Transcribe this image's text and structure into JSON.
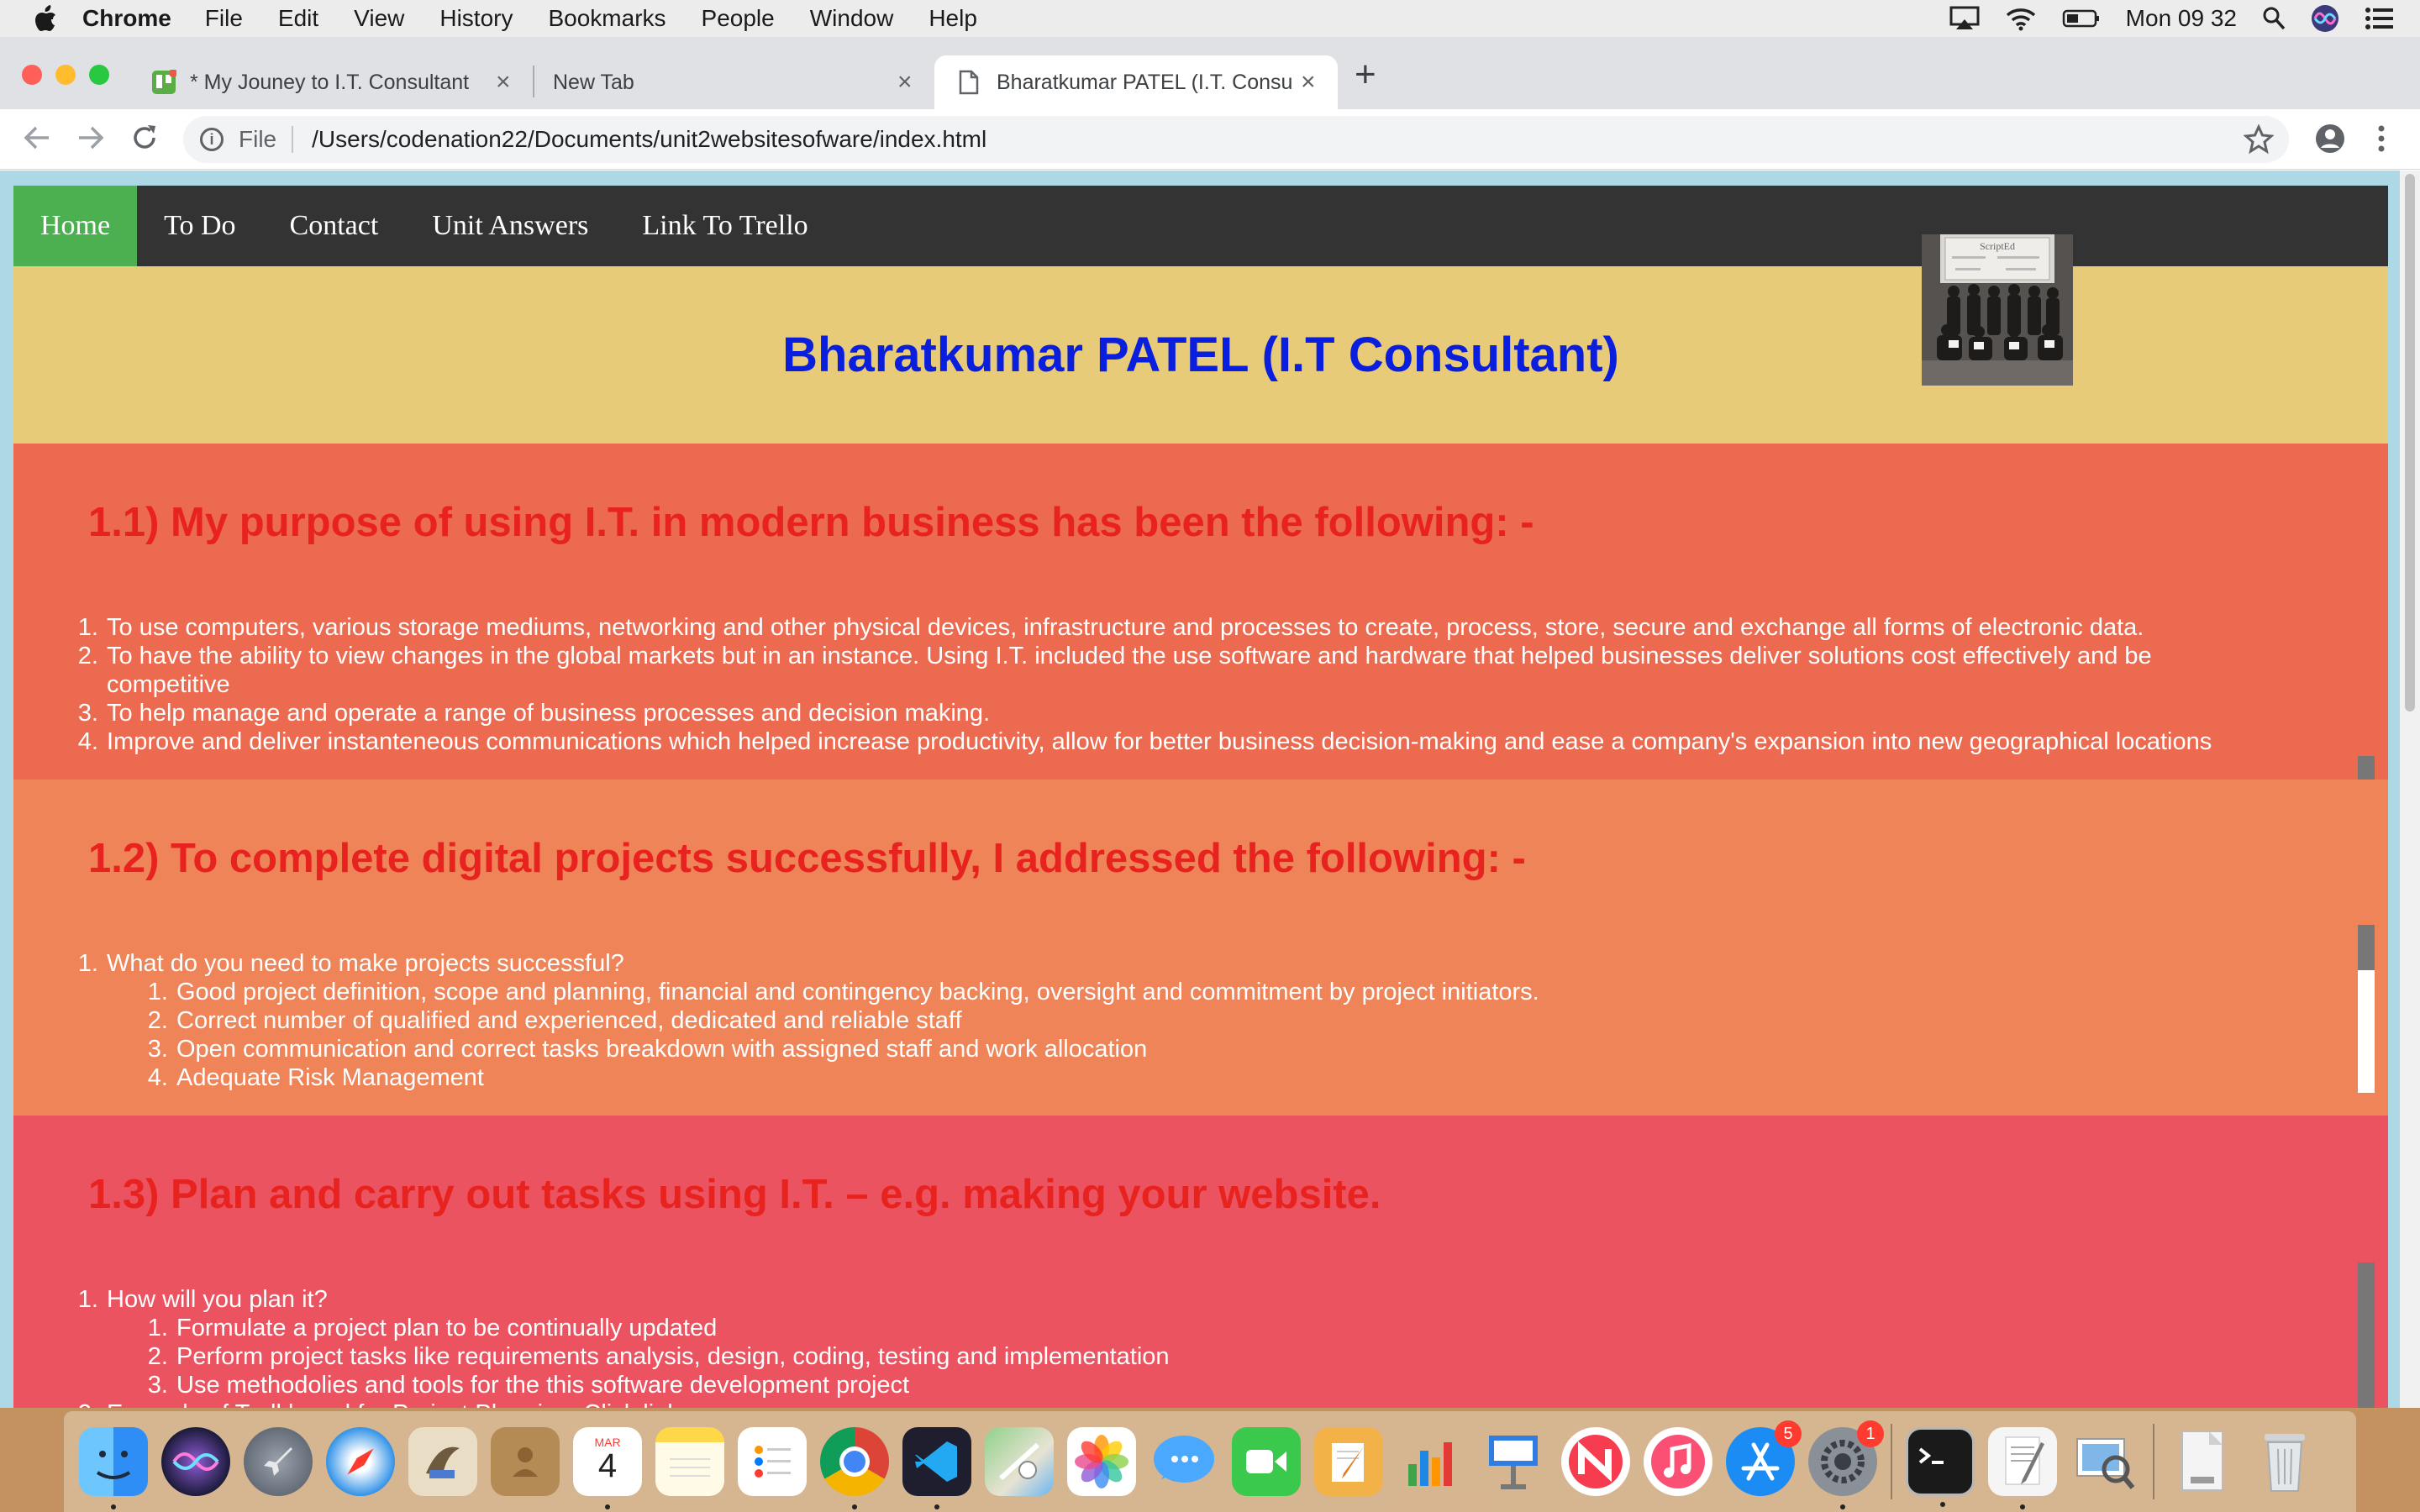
{
  "menubar": {
    "app_name": "Chrome",
    "items": [
      "File",
      "Edit",
      "View",
      "History",
      "Bookmarks",
      "People",
      "Window",
      "Help"
    ],
    "clock": "Mon 09 32"
  },
  "tabs": [
    {
      "title": "* My Jouney to I.T. Consultant",
      "close": "×",
      "icon": "trello-icon"
    },
    {
      "title": "New Tab",
      "close": "×"
    },
    {
      "title": "Bharatkumar PATEL (I.T. Consu",
      "close": "×",
      "icon": "document-icon"
    }
  ],
  "newtab_label": "+",
  "address_bar": {
    "scheme": "File",
    "url": "/Users/codenation22/Documents/unit2websitesofware/index.html"
  },
  "site": {
    "nav": [
      "Home",
      "To Do",
      "Contact",
      "Unit Answers",
      "Link To Trello"
    ],
    "header_title": "Bharatkumar PATEL (I.T Consultant)",
    "photo_caption": "ScriptEd",
    "sections": [
      {
        "heading": "1.1) My purpose of using I.T. in modern business has been the following: -",
        "items": [
          "To use computers, various storage mediums, networking and other physical devices, infrastructure and processes to create, process, store, secure and exchange all forms of electronic data.",
          "To have the ability to view changes in the global markets but in an instance. Using I.T. included the use software and hardware that helped businesses deliver solutions cost effectively and be competitive",
          "To help manage and operate a range of business processes and decision making.",
          "Improve and deliver instanteneous communications which helped increase productivity, allow for better business decision-making and ease a company's expansion into new geographical locations"
        ]
      },
      {
        "heading": "1.2) To complete digital projects successfully, I addressed the following: -",
        "item": "What do you need to make projects successful?",
        "subitems": [
          "Good project definition, scope and planning, financial and contingency backing, oversight and commitment by project initiators.",
          "Correct number of qualified and experienced, dedicated and reliable staff",
          "Open communication and correct tasks breakdown with assigned staff and work allocation",
          "Adequate Risk Management"
        ]
      },
      {
        "heading": "1.3) Plan and carry out tasks using I.T. – e.g. making your website.",
        "item": "How will you plan it?",
        "subitems": [
          "Formulate a project plan to be continually updated",
          "Perform project tasks like requirements analysis, design, coding, testing and implementation",
          "Use methodolies and tools for the this software development project"
        ],
        "item2": "Example of Trell board for Project Planning. Click link"
      }
    ]
  },
  "dock": {
    "calendar_month": "MAR",
    "calendar_day": "4",
    "badges": {
      "app_store": "5",
      "system_preferences": "1"
    },
    "apps": [
      "finder",
      "siri",
      "launchpad",
      "safari",
      "mail",
      "contacts",
      "calendar",
      "notes",
      "reminders",
      "chrome",
      "vscode",
      "maps",
      "photos",
      "messages",
      "facetime",
      "pages",
      "numbers",
      "keynote",
      "news",
      "music",
      "app-store",
      "system-preferences",
      "terminal",
      "textedit",
      "preview",
      "documents",
      "trash"
    ]
  },
  "colors": {
    "nav_bg": "#333333",
    "nav_active": "#4caf50",
    "header_bg": "#e8cb78",
    "title_blue": "#0a1fdd",
    "heading_red": "#e8231f",
    "section1_bg": "#ec6a4f",
    "section2_bg": "#ef8459",
    "section3_bg": "#ec5360"
  }
}
